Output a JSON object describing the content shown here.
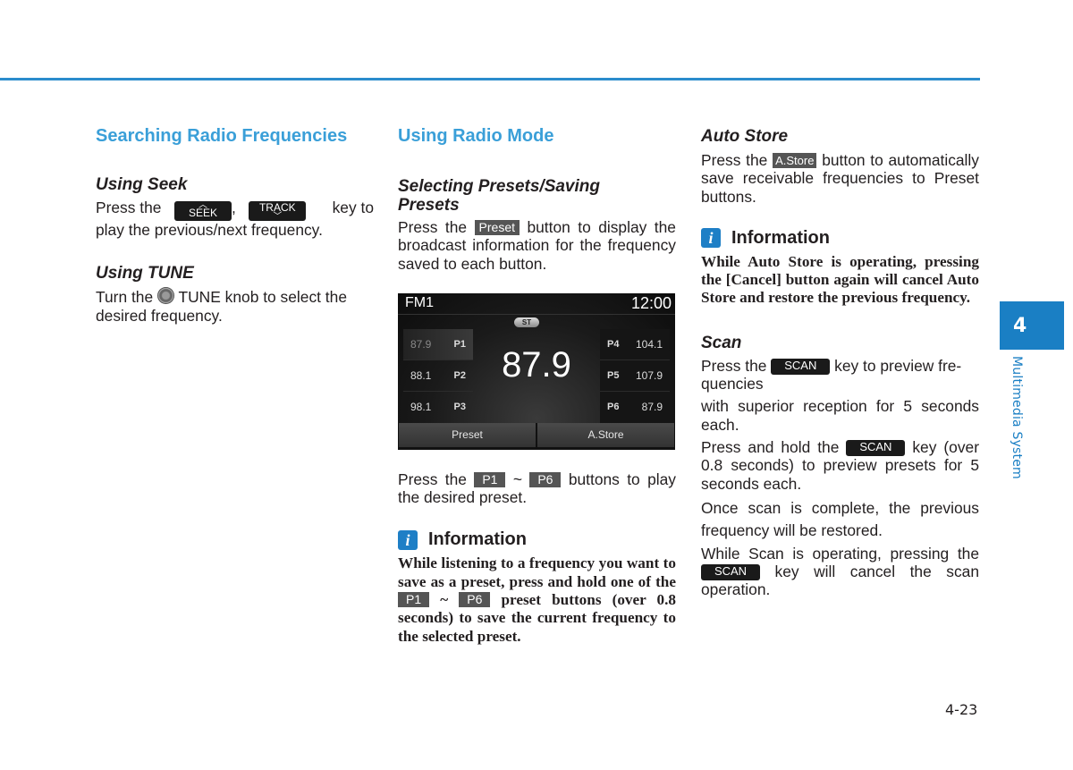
{
  "page_number": "4-23",
  "chapter": {
    "number": "4",
    "title": "Multimedia System"
  },
  "colors": {
    "accent_blue": "#3a9fd8",
    "rule_blue": "#2b8ccc",
    "tab_blue": "#1a7fc4",
    "info_icon": "#1e7fc6"
  },
  "col1": {
    "title": "Searching Radio Frequencies",
    "seek": {
      "heading": "Using Seek",
      "text_before": "Press the",
      "key1_label": "SEEK",
      "separator": ",",
      "key2_label": "TRACK",
      "text_after": "key to",
      "line2": "play the previous/next frequency."
    },
    "tune": {
      "heading": "Using TUNE",
      "text_before": "Turn the",
      "text_after": "TUNE knob to select the",
      "line2": "desired frequency."
    }
  },
  "col2": {
    "title": "Using Radio Mode",
    "presets": {
      "heading": "Selecting Presets/Saving Presets",
      "text_before": "Press the",
      "key_label": "Preset",
      "text_after": "button to display the broadcast information for the frequency saved to each button."
    },
    "screen": {
      "band": "FM1",
      "clock": "12:00",
      "stereo_badge": "ST",
      "current_frequency": "87.9",
      "presets_left": [
        {
          "freq": "87.9",
          "label": "P1",
          "active": true
        },
        {
          "freq": "88.1",
          "label": "P2"
        },
        {
          "freq": "98.1",
          "label": "P3"
        }
      ],
      "presets_right": [
        {
          "label": "P4",
          "freq": "104.1"
        },
        {
          "label": "P5",
          "freq": "107.9"
        },
        {
          "label": "P6",
          "freq": "87.9"
        }
      ],
      "buttons": {
        "preset": "Preset",
        "astore": "A.Store"
      }
    },
    "play_preset": {
      "text_before": "Press the",
      "key1": "P1",
      "tilde": "~",
      "key2": "P6",
      "text_after": "buttons to play the desired preset."
    },
    "info": {
      "icon": "i",
      "heading": "Information",
      "text_before": "While listening to a frequency you want to save as a preset, press and hold one of the",
      "key1": "P1",
      "tilde": "~",
      "key2": "P6",
      "text_after": "preset buttons (over 0.8 seconds) to save the current frequency to the selected preset."
    }
  },
  "col3": {
    "autostore": {
      "heading": "Auto Store",
      "text_before": "Press the",
      "key_label": "A.Store",
      "text_after": "button to automatically save receivable frequencies to Preset buttons."
    },
    "info": {
      "icon": "i",
      "heading": "Information",
      "text": "While Auto Store is operating, pressing the [Cancel] button again will cancel Auto Store and restore the previous frequency."
    },
    "scan": {
      "heading": "Scan",
      "p1_before": "Press the",
      "key_label": "SCAN",
      "p1_after": "key to preview fre-quencies",
      "p2": "with superior reception for 5 seconds each.",
      "p3_before": "Press and hold the",
      "p3_after": "key (over 0.8 seconds) to preview presets for 5 seconds each.",
      "p4": "Once scan is complete, the previous frequency will be restored.",
      "p5_before": "While Scan is operating, pressing the",
      "p5_after": "key will cancel the scan operation."
    }
  }
}
